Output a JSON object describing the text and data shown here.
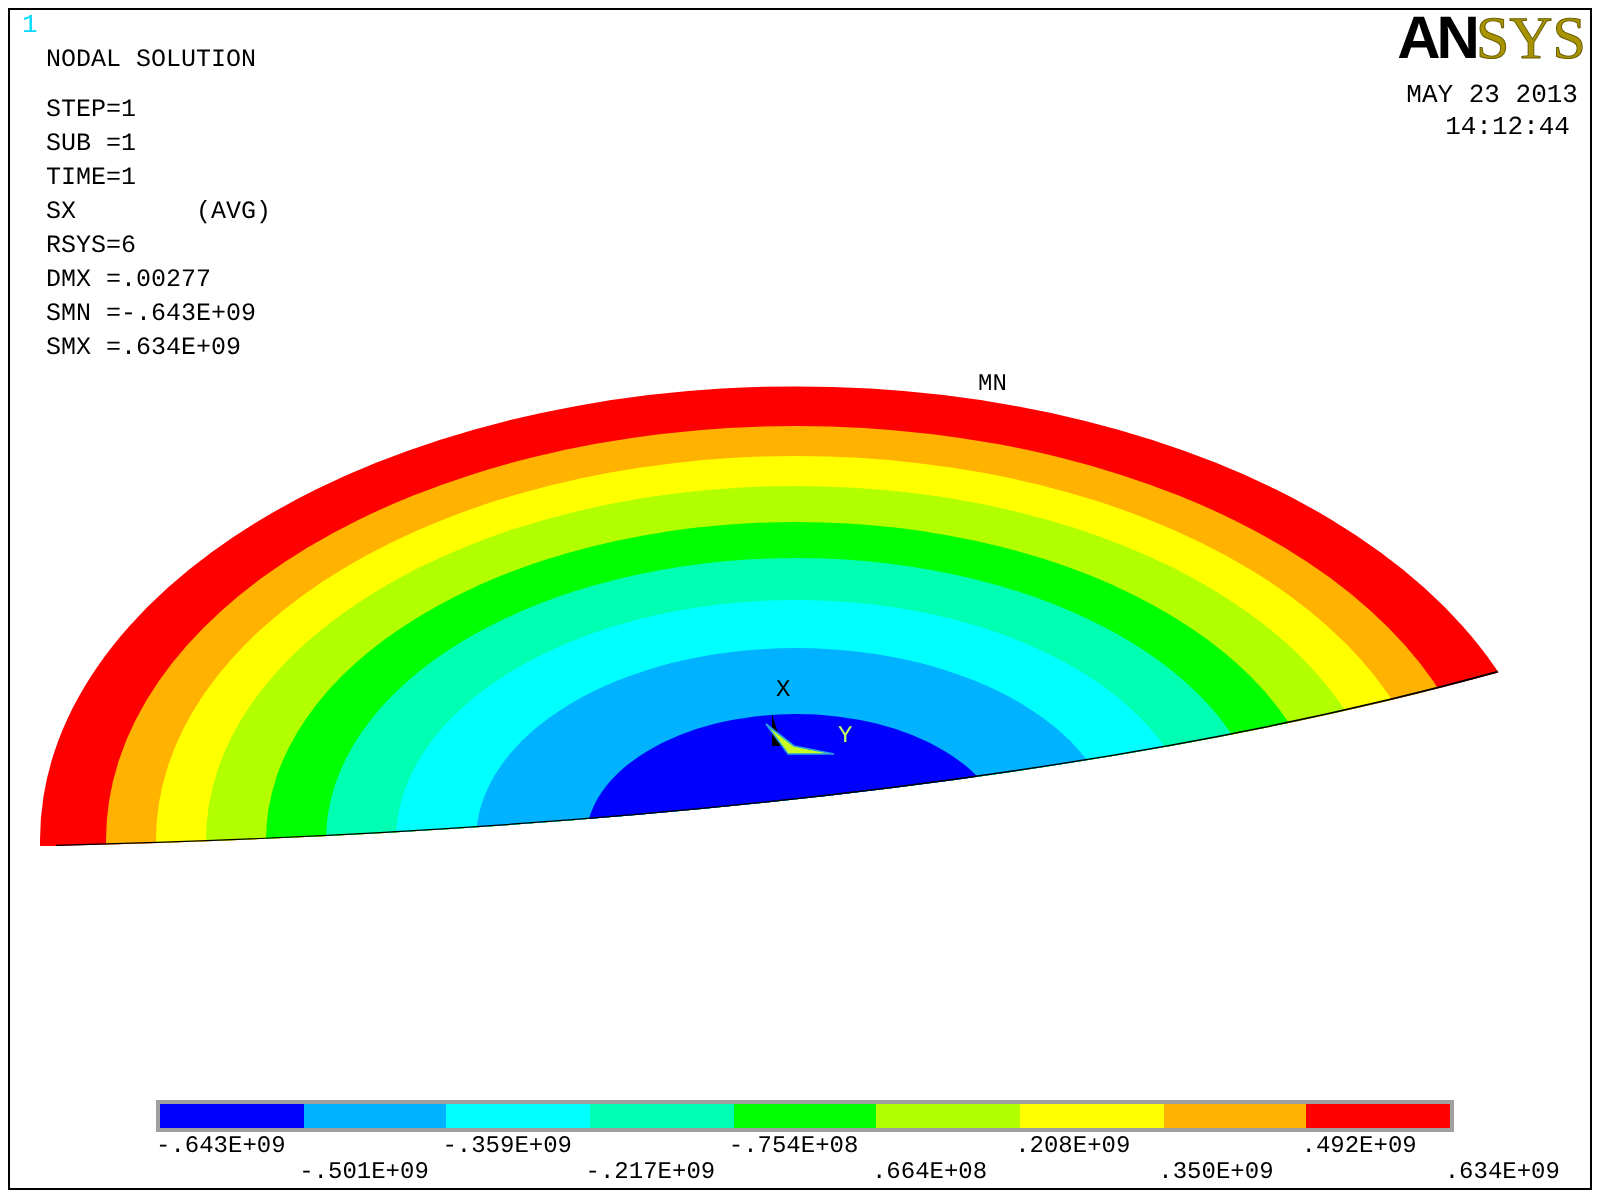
{
  "window_number": "1",
  "title": "NODAL SOLUTION",
  "info_lines": [
    "STEP=1",
    "SUB =1",
    "TIME=1",
    "SX        (AVG)",
    "RSYS=6",
    "DMX =.00277",
    "SMN =-.643E+09",
    "SMX =.634E+09"
  ],
  "logo": {
    "dark_part": "AN",
    "light_part": "SYS"
  },
  "date": "MAY 23 2013",
  "time": "14:12:44",
  "plot": {
    "min_label": "MN",
    "axis_x": "X",
    "axis_y": "Y"
  },
  "legend": {
    "colors": [
      {
        "color": "#0000ff"
      },
      {
        "color": "#00b2ff"
      },
      {
        "color": "#00ffff"
      },
      {
        "color": "#00ffb2"
      },
      {
        "color": "#00ff00"
      },
      {
        "color": "#b2ff00"
      },
      {
        "color": "#ffff00"
      },
      {
        "color": "#ffb200"
      },
      {
        "color": "#ff0000"
      }
    ],
    "labels": [
      "-.643E+09",
      "-.501E+09",
      "-.359E+09",
      "-.217E+09",
      "-.754E+08",
      ".664E+08",
      ".208E+09",
      ".350E+09",
      ".492E+09",
      ".634E+09"
    ]
  }
}
